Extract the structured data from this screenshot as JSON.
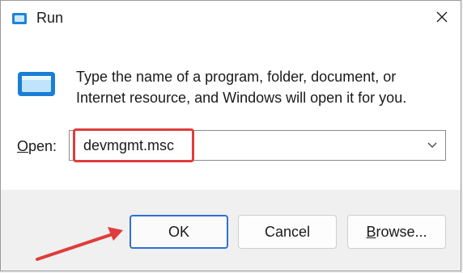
{
  "window": {
    "title": "Run",
    "close_icon": "close-icon",
    "app_icon": "run-icon"
  },
  "content": {
    "icon": "run-icon",
    "description": "Type the name of a program, folder, document, or Internet resource, and Windows will open it for you."
  },
  "open_field": {
    "label_prefix": "",
    "label_mnemonic": "O",
    "label_rest": "pen:",
    "value": "devmgmt.msc",
    "dropdown_icon": "chevron-down-icon"
  },
  "buttons": {
    "ok": "OK",
    "cancel": "Cancel",
    "browse_mnemonic": "B",
    "browse_rest": "rowse..."
  },
  "annotations": {
    "highlight_color": "#e03c3c",
    "arrow_color": "#e03c3c"
  },
  "colors": {
    "accent": "#2e6fd8",
    "footer_bg": "#f0f0f0"
  }
}
